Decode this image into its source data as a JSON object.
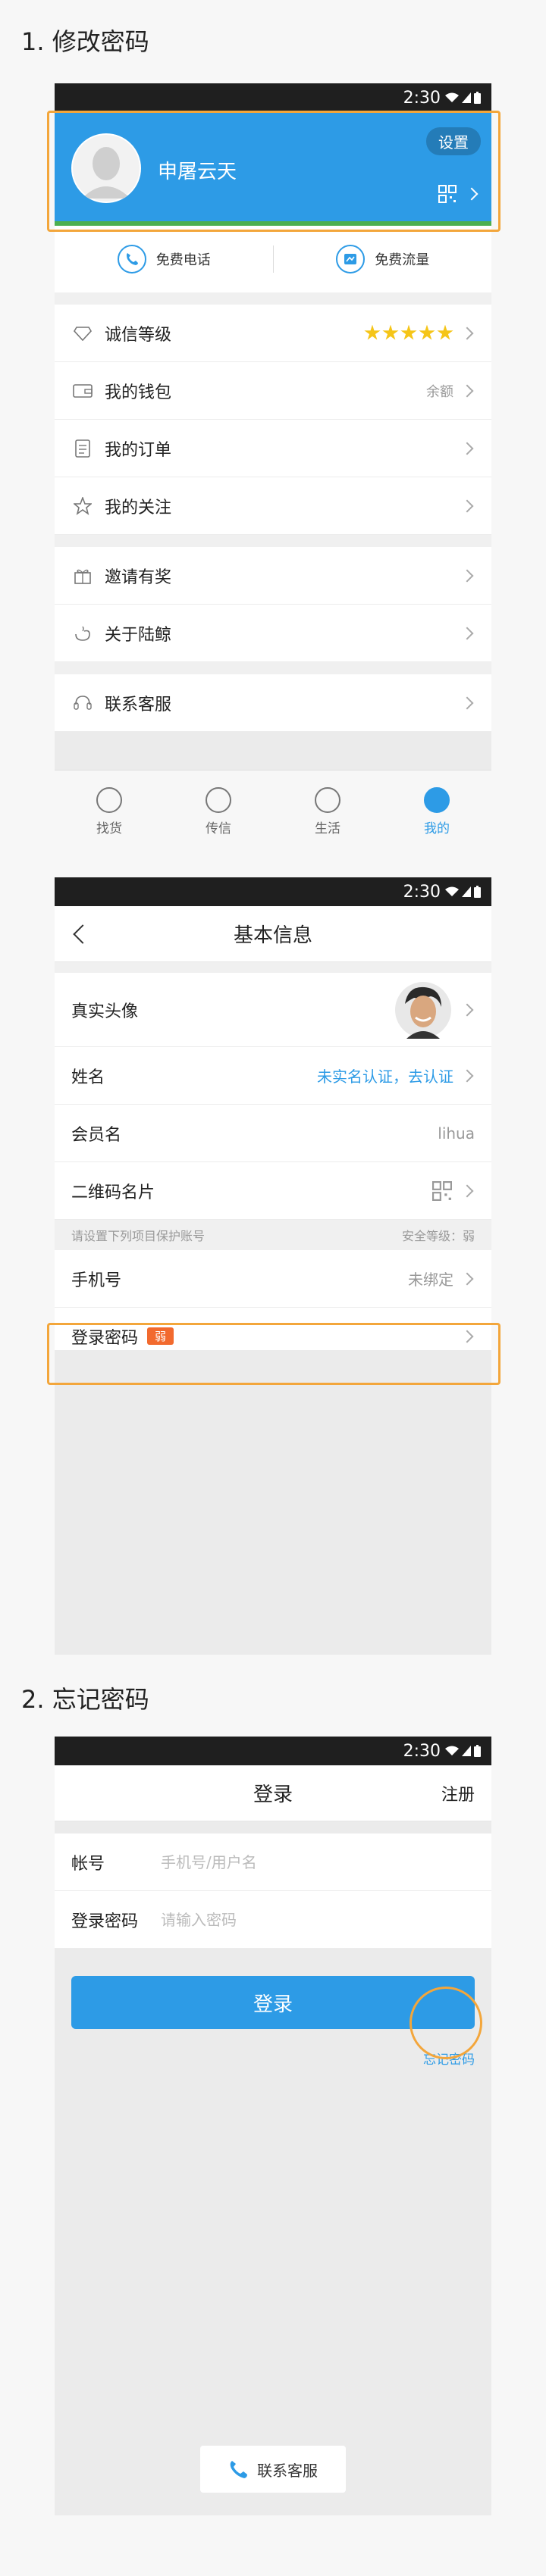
{
  "sections": {
    "s1_title": "1. 修改密码",
    "s2_title": "2. 忘记密码"
  },
  "status": {
    "time": "2:30"
  },
  "profile": {
    "username": "申屠云天",
    "settings_label": "设置"
  },
  "quick": {
    "free_call": "免费电话",
    "free_data": "免费流量"
  },
  "menu": {
    "credit": {
      "label": "诚信等级",
      "stars": 5
    },
    "wallet": {
      "label": "我的钱包",
      "right": "余额"
    },
    "orders": {
      "label": "我的订单"
    },
    "follow": {
      "label": "我的关注"
    },
    "invite": {
      "label": "邀请有奖"
    },
    "about": {
      "label": "关于陆鲸"
    },
    "service": {
      "label": "联系客服"
    }
  },
  "tabs": [
    {
      "label": "找货"
    },
    {
      "label": "传信"
    },
    {
      "label": "生活"
    },
    {
      "label": "我的"
    }
  ],
  "basic": {
    "title": "基本信息",
    "avatar_label": "真实头像",
    "name_label": "姓名",
    "name_value": "未实名认证，去认证",
    "member_label": "会员名",
    "member_value": "lihua",
    "qrcard_label": "二维码名片",
    "notice": "请设置下列项目保护账号",
    "security": "安全等级：弱",
    "phone_label": "手机号",
    "phone_value": "未绑定",
    "pwd_label": "登录密码",
    "pwd_badge": "弱"
  },
  "login": {
    "title": "登录",
    "register": "注册",
    "account_label": "帐号",
    "account_placeholder": "手机号/用户名",
    "pwd_label": "登录密码",
    "pwd_placeholder": "请输入密码",
    "submit": "登录",
    "forgot": "忘记密码",
    "contact": "联系客服"
  },
  "colors": {
    "accent": "#2d9be6",
    "highlight": "#f3a63b",
    "badge": "#f26a2e"
  }
}
